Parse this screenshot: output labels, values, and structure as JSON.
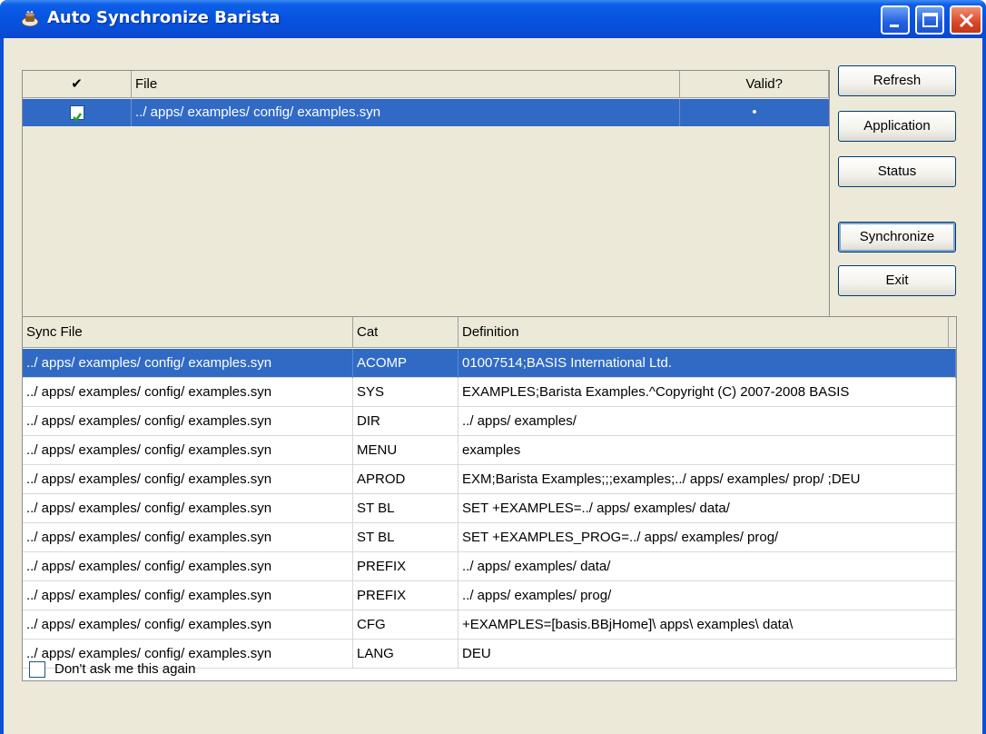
{
  "window": {
    "title": "Auto Synchronize Barista"
  },
  "top_grid": {
    "columns": [
      "✔",
      "File",
      "Valid?"
    ],
    "rows": [
      {
        "checked": true,
        "file": "../ apps/ examples/ config/ examples.syn",
        "valid": "•"
      }
    ]
  },
  "buttons": {
    "refresh": "Refresh",
    "application": "Application",
    "status": "Status",
    "synchronize": "Synchronize",
    "exit": "Exit"
  },
  "bottom_grid": {
    "columns": [
      "Sync File",
      "Cat",
      "Definition"
    ],
    "rows": [
      {
        "file": "../ apps/ examples/ config/ examples.syn",
        "cat": "ACOMP",
        "definition": "01007514;BASIS International Ltd."
      },
      {
        "file": "../ apps/ examples/ config/ examples.syn",
        "cat": "SYS",
        "definition": "EXAMPLES;Barista Examples.^Copyright (C) 2007-2008 BASIS"
      },
      {
        "file": "../ apps/ examples/ config/ examples.syn",
        "cat": "DIR",
        "definition": "../ apps/ examples/"
      },
      {
        "file": "../ apps/ examples/ config/ examples.syn",
        "cat": "MENU",
        "definition": "examples"
      },
      {
        "file": "../ apps/ examples/ config/ examples.syn",
        "cat": "APROD",
        "definition": "EXM;Barista Examples;;;examples;../ apps/ examples/ prop/ ;DEU"
      },
      {
        "file": "../ apps/ examples/ config/ examples.syn",
        "cat": "ST BL",
        "definition": "SET +EXAMPLES=../ apps/ examples/ data/"
      },
      {
        "file": "../ apps/ examples/ config/ examples.syn",
        "cat": "ST BL",
        "definition": "SET +EXAMPLES_PROG=../ apps/ examples/ prog/"
      },
      {
        "file": "../ apps/ examples/ config/ examples.syn",
        "cat": "PREFIX",
        "definition": "../ apps/ examples/ data/"
      },
      {
        "file": "../ apps/ examples/ config/ examples.syn",
        "cat": "PREFIX",
        "definition": "../ apps/ examples/ prog/"
      },
      {
        "file": "../ apps/ examples/ config/ examples.syn",
        "cat": "CFG",
        "definition": "+EXAMPLES=[basis.BBjHome]\\ apps\\ examples\\ data\\"
      },
      {
        "file": "../ apps/ examples/ config/ examples.syn",
        "cat": "LANG",
        "definition": "DEU"
      }
    ],
    "selected_row": 0
  },
  "footer": {
    "dont_ask_label": "Don't ask me this again",
    "dont_ask_checked": false
  },
  "colors": {
    "titlebar": "#0553e0",
    "selection": "#316ac5",
    "dialog_bg": "#ece9d8"
  }
}
